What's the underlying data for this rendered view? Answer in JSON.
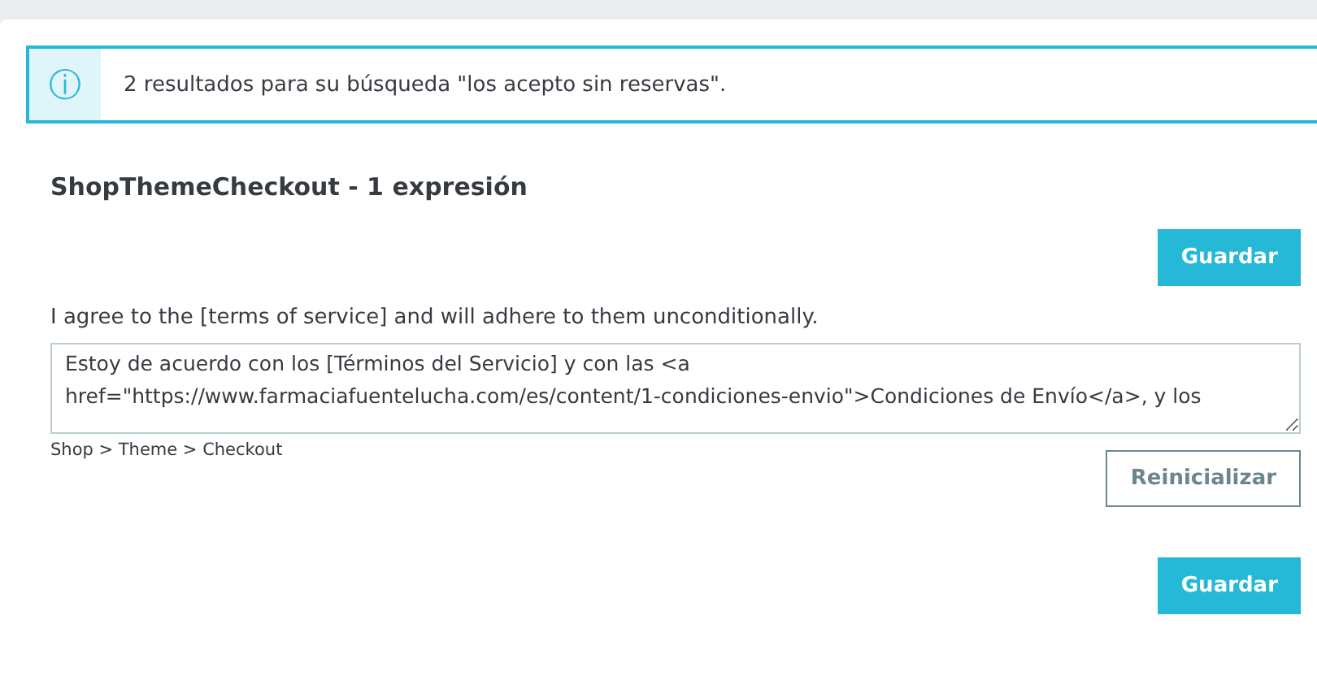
{
  "alert": {
    "icon": "ⓘ",
    "text": "2 resultados para su búsqueda \"los acepto sin reservas\"."
  },
  "section": {
    "title": "ShopThemeCheckout - 1 expresión",
    "top_button": "Guardar",
    "source_text": "I agree to the [terms of service] and will adhere to them unconditionally.",
    "translation": "Estoy de acuerdo con los [Términos del Servicio] y con las <a href=\"https://www.farmaciafuentelucha.com/es/content/1-condiciones-envio\">Condiciones de Envío</a>, y los",
    "breadcrumb": "Shop > Theme > Checkout",
    "reset_button": "Reinicializar",
    "bottom_button": "Guardar"
  }
}
